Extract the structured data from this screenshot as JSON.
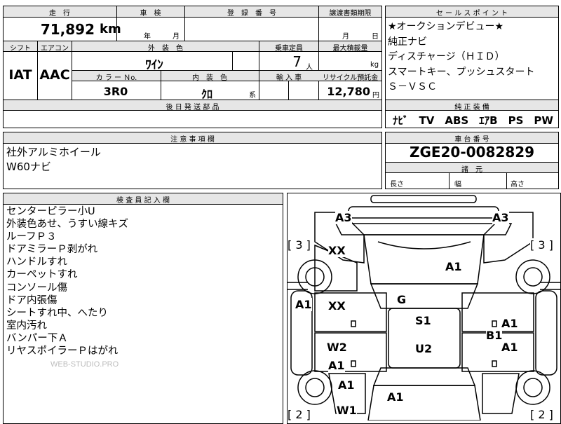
{
  "top": {
    "mileage_label": "走　行",
    "inspection_label": "車　検",
    "registration_label": "登　録　番　号",
    "transfer_label": "譲渡書類期限",
    "mileage_value": "71,892",
    "mileage_unit": "km",
    "inspection_year_unit": "年",
    "inspection_month_unit": "月",
    "transfer_month_unit": "月",
    "transfer_day_unit": "日",
    "shift_label": "シフト",
    "aircon_label": "エアコン",
    "exterior_color_label": "外　装　色",
    "capacity_label": "乗車定員",
    "max_load_label": "最大積載量",
    "shift_value": "IAT",
    "aircon_value": "AAC",
    "exterior_color_value": "ﾜｲﾝ",
    "capacity_value": "7",
    "capacity_unit": "人",
    "load_unit": "kg",
    "color_no_label": "カ ラ ー Ｎo.",
    "interior_color_label": "内　装　色",
    "import_label": "輸 入 車",
    "recycle_label": "リサイクル預託金",
    "color_no_value": "3R0",
    "interior_color_value": "ｸﾛ",
    "interior_suffix": "系",
    "recycle_value": "12,780",
    "recycle_unit": "円",
    "later_parts_label": "後 日 発 送 部 品"
  },
  "sales_points": {
    "header": "セ ー ル ス ポ イ ン ト",
    "lines": [
      "★オークションデビュー★",
      "純正ナビ",
      "ディスチャージ（ＨＩＤ）",
      "スマートキー、プッシュスタート",
      "Ｓ－ＶＳＣ"
    ]
  },
  "equipment": {
    "header": "純 正 装 備",
    "value": "ﾅﾋﾞ　TV　ABS　ｴｱB　PS　PW"
  },
  "notes": {
    "header": "注 意 事 項 欄",
    "lines": [
      "社外アルミホイール",
      "W60ナビ"
    ]
  },
  "chassis": {
    "header": "車 台 番 号",
    "value": "ZGE20-0082829",
    "dims_header": "諸　元",
    "length_label": "長さ",
    "width_label": "幅",
    "height_label": "高さ"
  },
  "inspector": {
    "header": "検 査 員 記 入 欄",
    "lines": [
      "センターピラー小U",
      "外装色あせ、うすい線キズ",
      "ルーフＰ３",
      "ドアミラーＰ剥がれ",
      "ハンドルすれ",
      "カーペットすれ",
      "コンソール傷",
      "ドア内張傷",
      "シートすれ中、へたり",
      "室内汚れ",
      "バンパー下Ａ",
      "リヤスポイラーＰはがれ"
    ],
    "watermark": "WEB-STUDIO.PRO"
  },
  "diagram": {
    "marks": {
      "a3_left": "A3",
      "a3_right": "A3",
      "bracket_tl": "[ 3 ]",
      "bracket_tr": "[ 3 ]",
      "xx_top": "XX",
      "a1_hood": "A1",
      "a1_left_fender": "A1",
      "xx_mid": "XX",
      "g_mark": "G",
      "s1_mark": "S1",
      "a1_right_door": "A1",
      "b1_mark": "B1",
      "w2_mark": "W2",
      "u2_mark": "U2",
      "a1_right_rear": "A1",
      "a1_left_rear": "A1",
      "a1_left_bottom": "A1",
      "a1_trunk": "A1",
      "w1_mark": "W1",
      "bracket_bl": "[ 2 ]",
      "bracket_br": "[ 2 ]"
    }
  }
}
